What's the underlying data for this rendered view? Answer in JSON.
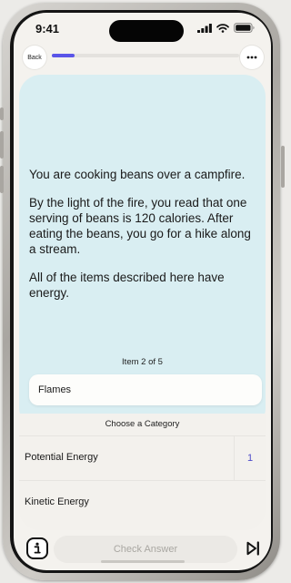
{
  "status_bar": {
    "time": "9:41"
  },
  "top_bar": {
    "back_label": "Back",
    "progress": 0.12
  },
  "scenario": {
    "paragraphs": [
      "You are cooking beans over a campfire.",
      "By the light of the fire, you read that one serving of beans is 120 calories. After eating the beans, you go for a hike along a stream.",
      "All of the items described here have energy."
    ]
  },
  "item": {
    "counter": "Item 2 of 5",
    "current_label": "Flames"
  },
  "categories": {
    "header": "Choose a Category",
    "items": [
      {
        "label": "Potential Energy",
        "count": "1"
      },
      {
        "label": "Kinetic Energy",
        "count": ""
      }
    ]
  },
  "bottom_bar": {
    "check_answer_label": "Check Answer"
  },
  "colors": {
    "accent": "#5a55e8",
    "card_bg": "#d9eef2",
    "count_text": "#4d4ac9"
  },
  "icons": {
    "more": "more-horizontal-icon",
    "info": "info-icon",
    "skip": "skip-forward-icon"
  }
}
